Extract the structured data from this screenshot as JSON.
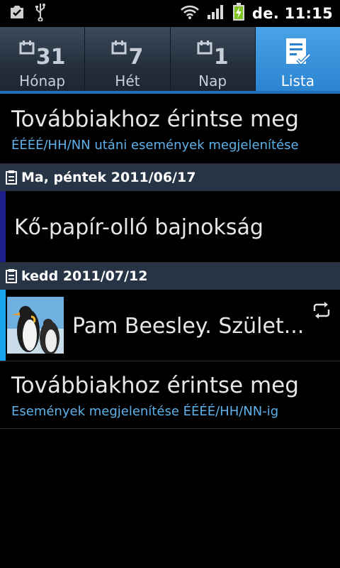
{
  "status_bar": {
    "time": "de. 11:15",
    "icons": [
      "checkbox-notification-icon",
      "usb-icon",
      "wifi-icon",
      "signal-icon",
      "battery-charging-icon"
    ]
  },
  "tabs": [
    {
      "label": "Hónap",
      "number": "31",
      "icon": "calendar-month-icon",
      "active": false
    },
    {
      "label": "Hét",
      "number": "7",
      "icon": "calendar-week-icon",
      "active": false
    },
    {
      "label": "Nap",
      "number": "1",
      "icon": "calendar-day-icon",
      "active": false
    },
    {
      "label": "Lista",
      "icon": "list-check-icon",
      "active": true
    }
  ],
  "colors": {
    "active_tab": "#2f8ad6",
    "link_text": "#5fb1ea",
    "event1_bar": "#1a1f8a",
    "event2_bar": "#1aa3ee",
    "date_header_bg": "#263446"
  },
  "list": {
    "more_before": {
      "title": "Továbbiakhoz érintse meg",
      "subtitle": "ÉÉÉÉ/HH/NN utáni események megjelenítése"
    },
    "groups": [
      {
        "date": "Ma, péntek 2011/06/17",
        "events": [
          {
            "title": "Kő-papír-olló bajnokság"
          }
        ]
      },
      {
        "date": "kedd 2011/07/12",
        "events": [
          {
            "title": "Pam Beesley. Szület...",
            "repeat_icon": "repeat-icon",
            "thumbnail": "penguin-photo"
          }
        ]
      }
    ],
    "more_after": {
      "title": "Továbbiakhoz érintse meg",
      "subtitle": "Események megjelenítése ÉÉÉÉ/HH/NN-ig"
    }
  }
}
